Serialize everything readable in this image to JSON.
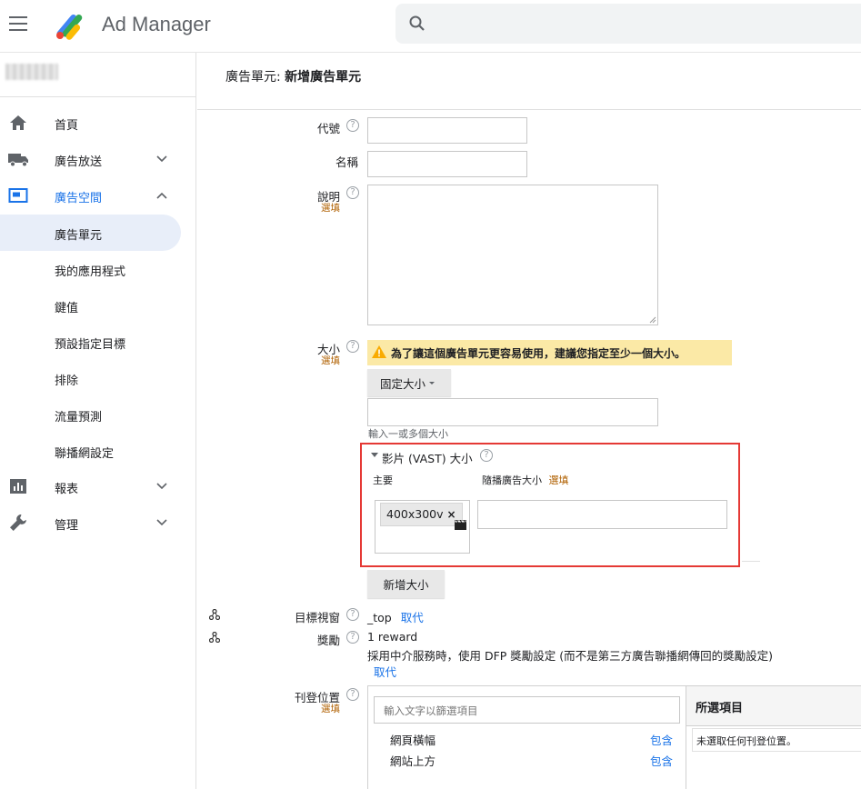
{
  "app": {
    "name": "Ad Manager"
  },
  "sidebar": {
    "items": [
      {
        "label": "首頁",
        "icon": "home-icon"
      },
      {
        "label": "廣告放送",
        "icon": "truck-icon"
      },
      {
        "label": "廣告空間",
        "icon": "inventory-icon"
      },
      {
        "label": "廣告單元"
      },
      {
        "label": "我的應用程式"
      },
      {
        "label": "鍵值"
      },
      {
        "label": "預設指定目標"
      },
      {
        "label": "排除"
      },
      {
        "label": "流量預測"
      },
      {
        "label": "聯播網設定"
      },
      {
        "label": "報表",
        "icon": "chart-icon"
      },
      {
        "label": "管理",
        "icon": "wrench-icon"
      }
    ]
  },
  "page": {
    "title_prefix": "廣告單元:",
    "title_main": "新增廣告單元"
  },
  "form": {
    "code_label": "代號",
    "name_label": "名稱",
    "desc_label": "說明",
    "optional": "選填",
    "size_label": "大小",
    "size_warning": "為了讓這個廣告單元更容易使用，建議您指定至少一個大小。",
    "fixed_size_button": "固定大小",
    "size_hint": "輸入一或多個大小",
    "vast_title": "影片 (VAST) 大小",
    "vast_primary": "主要",
    "vast_companion": "隨播廣告大小",
    "vast_chip": "400x300v",
    "add_size_button": "新增大小",
    "target_window_label": "目標視窗",
    "target_window_value": "_top",
    "override": "取代",
    "reward_label": "獎勵",
    "reward_value": "1 reward",
    "reward_note": "採用中介服務時，使用 DFP 獎勵設定 (而不是第三方廣告聯播網傳回的獎勵設定)",
    "placement_label": "刊登位置",
    "placement_filter_placeholder": "輸入文字以篩選項目",
    "placements": [
      {
        "name": "網頁橫幅",
        "action": "包含"
      },
      {
        "name": "網站上方",
        "action": "包含"
      }
    ],
    "selected_header": "所選項目",
    "selected_empty": "未選取任何刊登位置。"
  },
  "colors": {
    "accent": "#1a73e8",
    "warning_bg": "#fbe9a6",
    "highlight_box": "#e53935",
    "optional_text": "#b06000"
  }
}
